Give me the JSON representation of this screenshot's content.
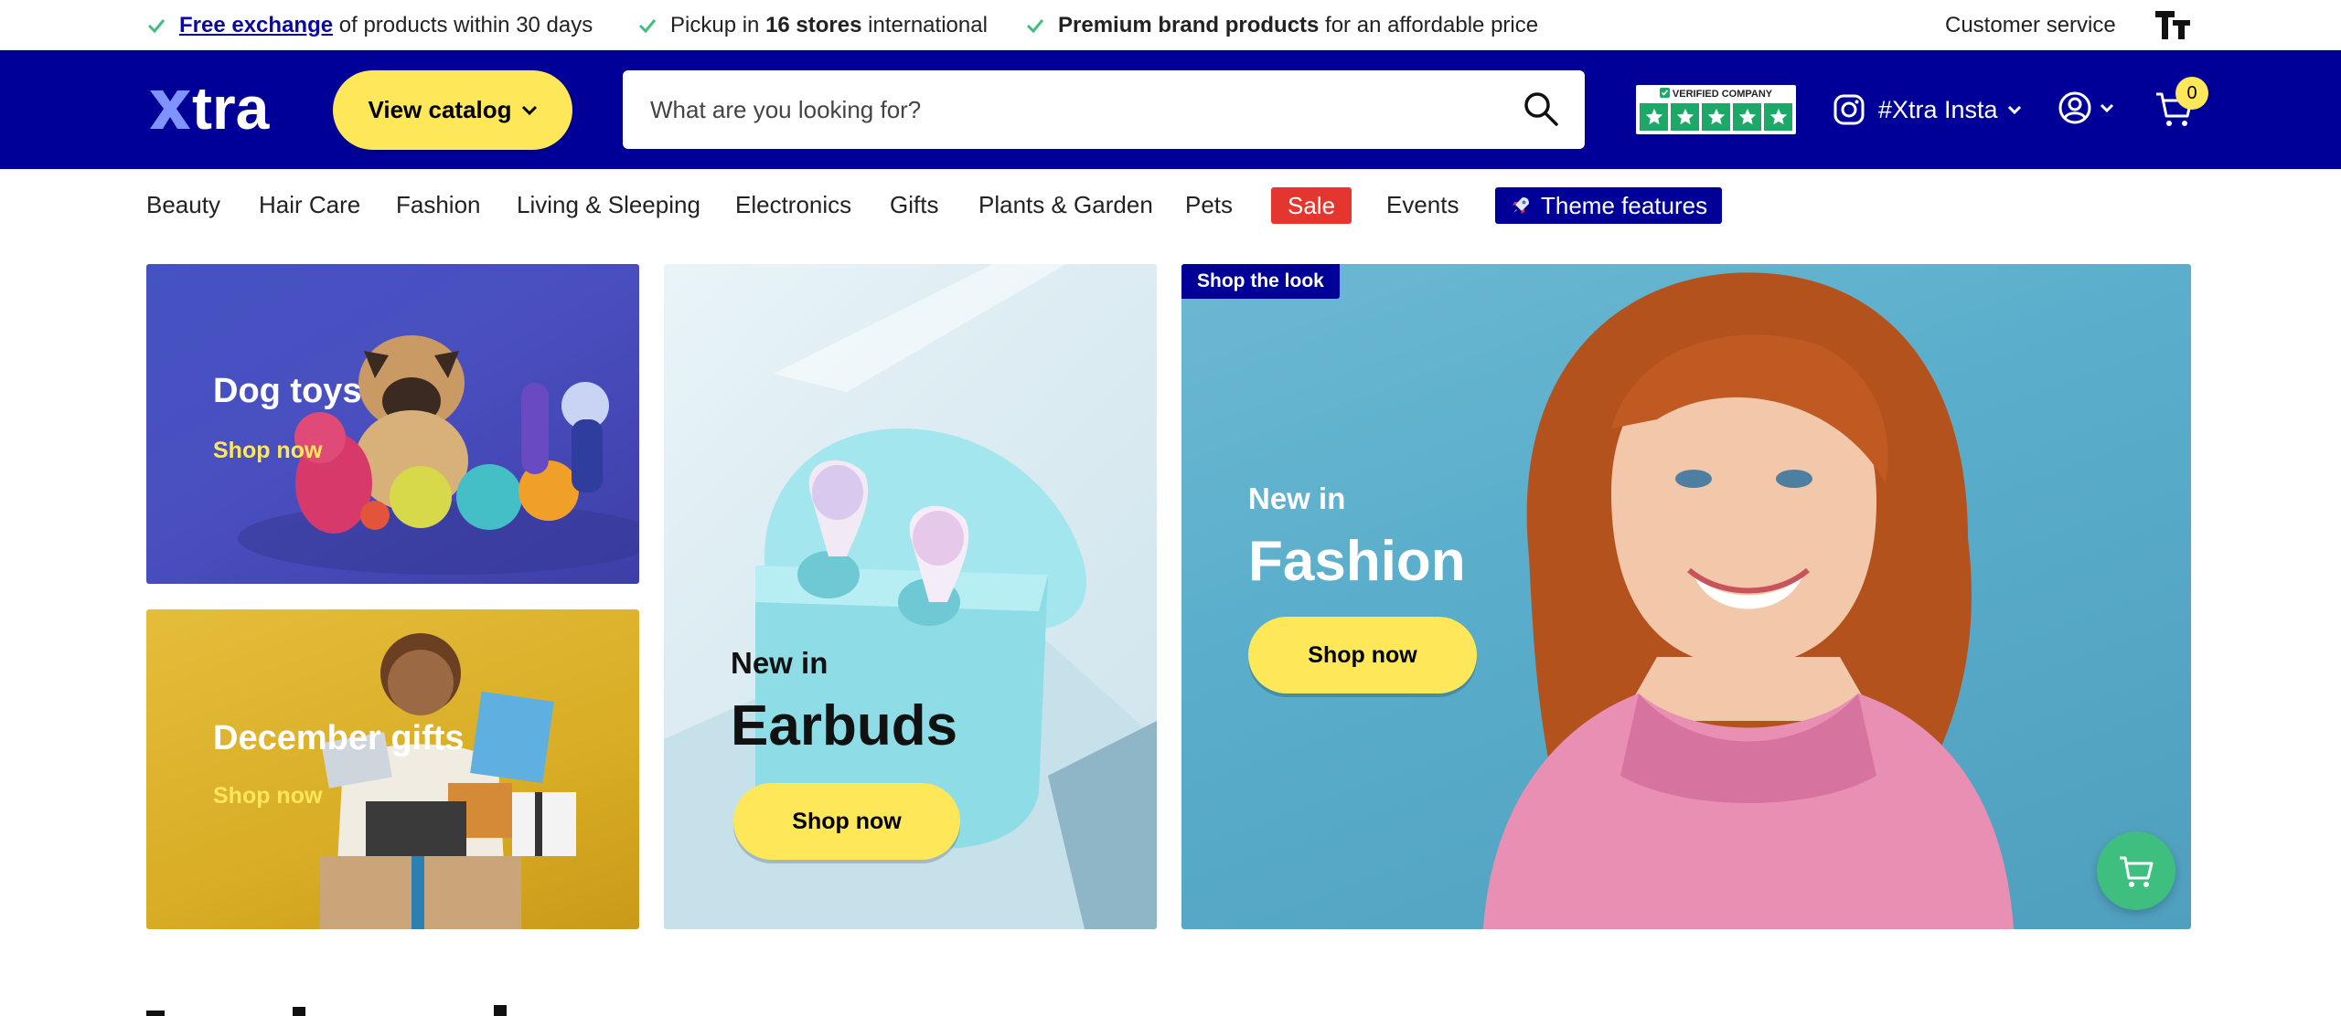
{
  "topbar": {
    "usp1": {
      "link": "Free exchange",
      "rest": " of products within 30 days"
    },
    "usp2": {
      "pre": "Pickup in ",
      "bold": "16 stores",
      "post": " international"
    },
    "usp3": {
      "bold": "Premium brand products",
      "rest": " for an affordable price"
    },
    "customer_service": "Customer service",
    "text_size_icon": "text-size-icon"
  },
  "header": {
    "logo": "xtra",
    "catalog_label": "View catalog",
    "search_placeholder": "What are you looking for?",
    "trust_label": "VERIFIED COMPANY",
    "trust_stars": 5,
    "instagram_label": "#Xtra Insta",
    "cart_count": "0"
  },
  "nav": {
    "items": [
      "Beauty",
      "Hair Care",
      "Fashion",
      "Living & Sleeping",
      "Electronics",
      "Gifts",
      "Plants & Garden",
      "Pets"
    ],
    "sale": "Sale",
    "events": "Events",
    "theme": "Theme features"
  },
  "tiles": {
    "dog": {
      "title": "Dog toys",
      "link": "Shop now"
    },
    "gifts": {
      "title": "December gifts",
      "link": "Shop now"
    },
    "earbuds": {
      "kicker": "New in",
      "title": "Earbuds",
      "button": "Shop now"
    },
    "fashion": {
      "badge": "Shop the look",
      "kicker": "New in",
      "title": "Fashion",
      "button": "Shop now"
    }
  },
  "colors": {
    "brand_blue": "#000099",
    "accent_yellow": "#ffe75a",
    "sale_red": "#e5352f",
    "check_green": "#3fbf7f"
  }
}
